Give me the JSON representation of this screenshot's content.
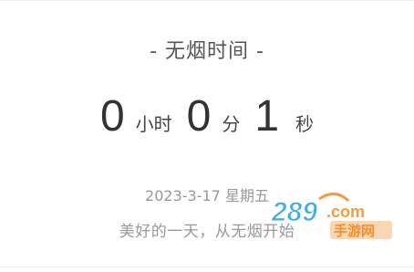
{
  "title": "- 无烟时间 -",
  "timer": {
    "hours": "0",
    "hours_unit": "小时",
    "minutes": "0",
    "minutes_unit": "分",
    "seconds": "1",
    "seconds_unit": "秒"
  },
  "date_line": "2023-3-17 星期五",
  "slogan": "美好的一天，从无烟开始",
  "watermark": {
    "text": "289.com 手游网",
    "colors": {
      "number": "#2aa6e6",
      "accent": "#f28a1f"
    }
  }
}
